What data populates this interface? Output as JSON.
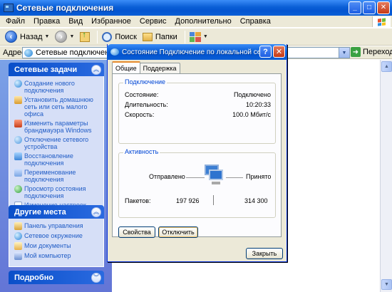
{
  "window": {
    "title": "Сетевые подключения"
  },
  "menu": [
    "Файл",
    "Правка",
    "Вид",
    "Избранное",
    "Сервис",
    "Дополнительно",
    "Справка"
  ],
  "toolbar": {
    "back": "Назад",
    "search": "Поиск",
    "folders": "Папки"
  },
  "address": {
    "label": "Адрес:",
    "value": "Сетевые подключения",
    "go": "Переход"
  },
  "network_tasks": {
    "title": "Сетевые задачи",
    "items": [
      "Создание нового подключения",
      "Установить домашнюю сеть или сеть малого офиса",
      "Изменить параметры брандмауэра Windows",
      "Отключение сетевого устройства",
      "Восстановление подключения",
      "Переименование подключения",
      "Просмотр состояния подключения",
      "Изменение настроек подключения"
    ]
  },
  "other_places": {
    "title": "Другие места",
    "items": [
      "Панель управления",
      "Сетевое окружение",
      "Мои документы",
      "Мой компьютер"
    ]
  },
  "details": {
    "title": "Подробно"
  },
  "dialog": {
    "title": "Состояние Подключение по локальной сет...",
    "tabs": [
      "Общие",
      "Поддержка"
    ],
    "connection": {
      "group_title": "Подключение",
      "status_label": "Состояние:",
      "status_value": "Подключено",
      "duration_label": "Длительность:",
      "duration_value": "10:20:33",
      "speed_label": "Скорость:",
      "speed_value": "100.0 Мбит/с"
    },
    "activity": {
      "group_title": "Активность",
      "sent_label": "Отправлено",
      "received_label": "Принято",
      "packets_label": "Пакетов:",
      "packets_sent": "197 926",
      "packets_received": "314 300"
    },
    "buttons": {
      "properties": "Свойства",
      "disable": "Отключить",
      "close": "Закрыть"
    }
  },
  "colors": {
    "title_blue": "#0a5fd6",
    "task_pane": "#6f8fdf",
    "link_blue": "#215dc6",
    "group_blue": "#0046d5"
  }
}
